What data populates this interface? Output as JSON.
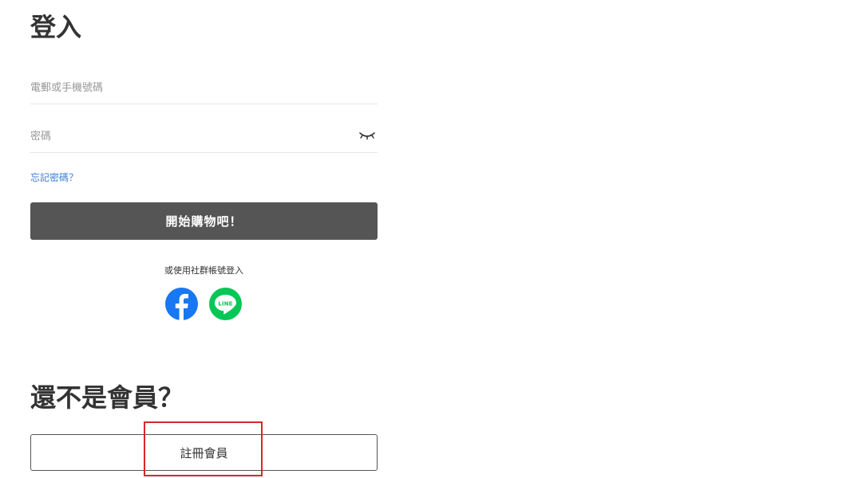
{
  "login": {
    "title": "登入",
    "email_placeholder": "電郵或手機號碼",
    "email_value": "",
    "password_placeholder": "密碼",
    "password_value": "",
    "forgot_password": "忘記密碼？",
    "submit_label": "開始購物吧！",
    "social_hint": "或使用社群帳號登入"
  },
  "social": [
    {
      "icon": "facebook-icon",
      "color": "#1877f2"
    },
    {
      "icon": "line-icon",
      "label": "LINE",
      "color": "#06c755"
    }
  ],
  "signup": {
    "title": "還不是會員？",
    "button_label": "註冊會員"
  },
  "colors": {
    "primary_button": "#555555",
    "link": "#3b7dd8",
    "highlight": "#d9262c"
  }
}
